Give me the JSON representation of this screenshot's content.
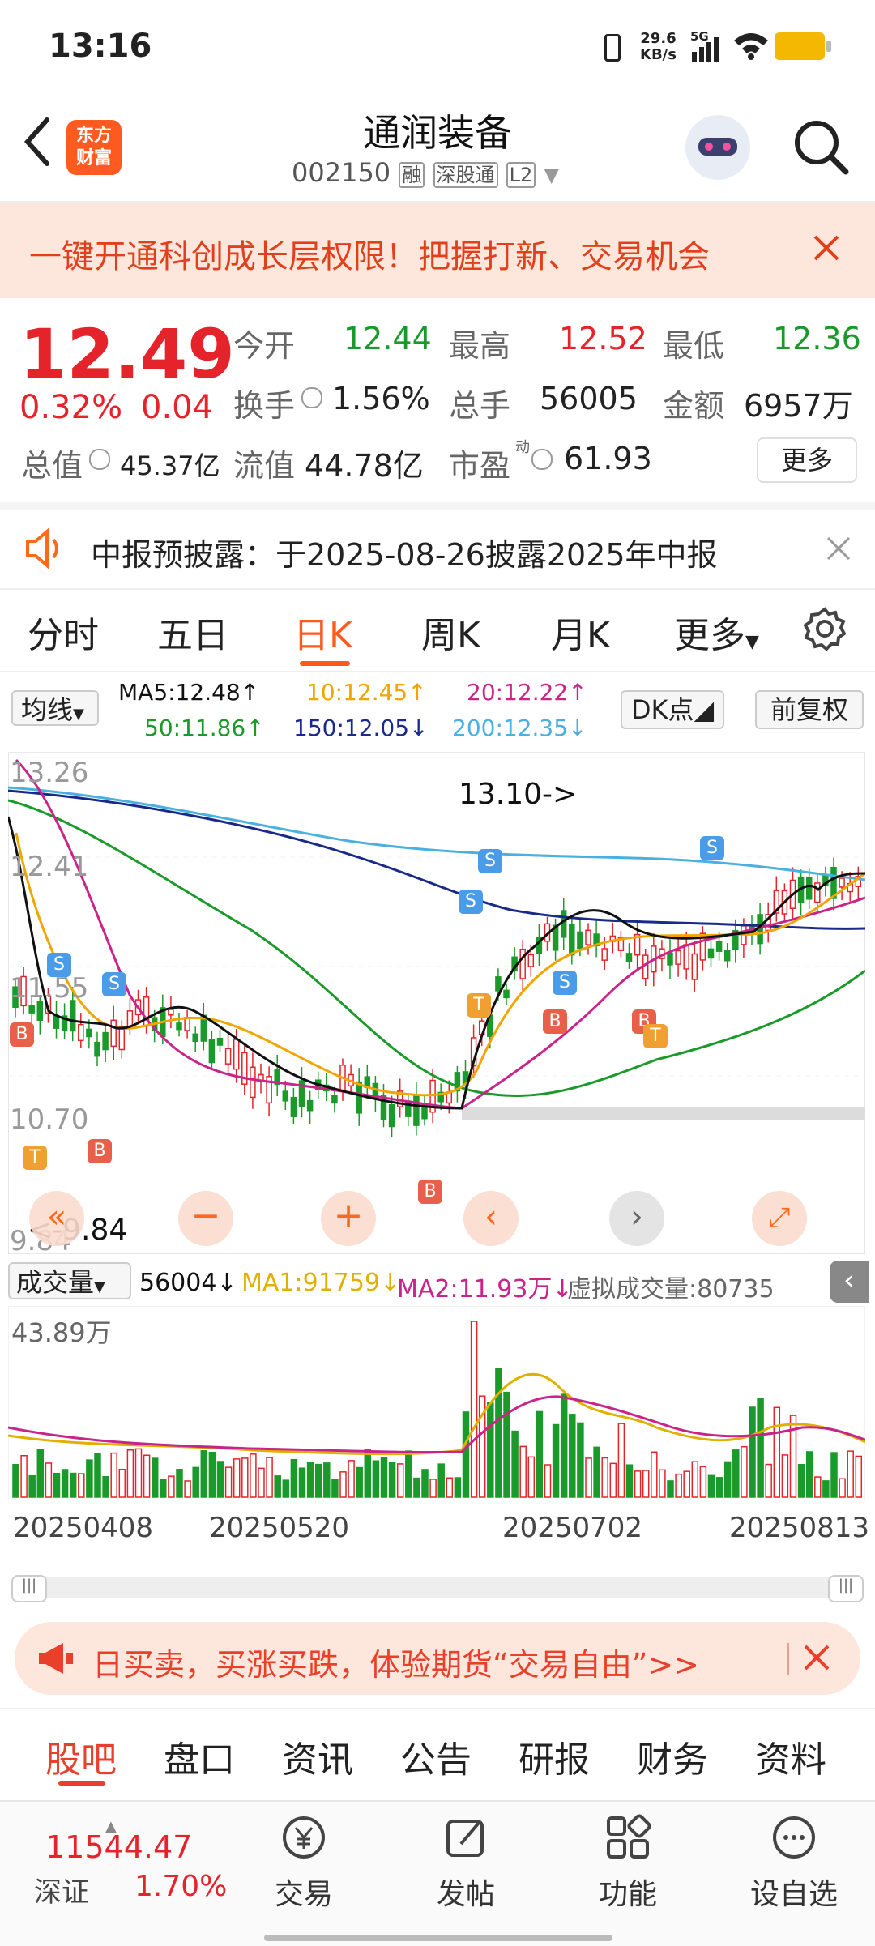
{
  "status": {
    "time": "13:16",
    "net_speed": "29.6",
    "net_unit": "KB/s",
    "signal": "5G"
  },
  "header": {
    "back": "‹",
    "logo_line1": "东方",
    "logo_line2": "财富",
    "title": "通润装备",
    "code": "002150",
    "tag1": "融",
    "tag2": "深股通",
    "tag3": "L2"
  },
  "banner": {
    "text": "一键开通科创成长层权限！把握打新、交易机会"
  },
  "quote": {
    "price": "12.49",
    "pct": "0.32%",
    "chg": "0.04",
    "open_label": "今开",
    "open": "12.44",
    "high_label": "最高",
    "high": "12.52",
    "low_label": "最低",
    "low": "12.36",
    "turnover_label": "换手",
    "turnover": "1.56%",
    "vol_label": "总手",
    "vol": "56005",
    "amount_label": "金额",
    "amount": "6957万",
    "mktcap_label": "总值",
    "mktcap": "45.37亿",
    "float_label": "流值",
    "float": "44.78亿",
    "pe_label": "市盈",
    "pe_sup": "动",
    "pe": "61.93",
    "more": "更多"
  },
  "notice": {
    "text": "中报预披露：于2025-08-26披露2025年中报"
  },
  "tabs": [
    "分时",
    "五日",
    "日K",
    "周K",
    "月K",
    "更多"
  ],
  "ma": {
    "toggle": "均线",
    "ma5": "MA5:12.48↑",
    "ma10": "10:12.45↑",
    "ma20": "20:12.22↑",
    "ma50": "50:11.86↑",
    "ma150": "150:12.05↓",
    "ma200": "200:12.35↓",
    "dk": "DK点",
    "fq": "前复权"
  },
  "chart_labels": {
    "y1": "13.26",
    "y2": "12.41",
    "y3": "11.55",
    "y4": "10.70",
    "y5": "9.84",
    "high_note": "13.10->",
    "low_note": "<-9.84"
  },
  "chart_data": {
    "type": "candlestick",
    "y_ticks": [
      13.26,
      12.41,
      11.55,
      10.7,
      9.84
    ],
    "ylim": [
      9.84,
      13.26
    ],
    "x_ticks": [
      "20250408",
      "20250520",
      "20250702",
      "20250813"
    ],
    "annotations": {
      "high": "13.10",
      "low": "9.84"
    },
    "ma_values": {
      "MA5": 12.48,
      "MA10": 12.45,
      "MA20": 12.22,
      "MA50": 11.86,
      "MA150": 12.05,
      "MA200": 12.35
    },
    "volume": {
      "current": 56004,
      "MA1": 91759,
      "MA2": "11.93万",
      "virtual": 80735,
      "max_label": "43.89万"
    }
  },
  "volume_bar": {
    "label": "成交量",
    "cur": "56004↓",
    "ma1": "MA1:91759↓",
    "ma2": "MA2:11.93万↓",
    "virtual": "虚拟成交量:80735",
    "max": "43.89万"
  },
  "dates": [
    "20250408",
    "20250520",
    "20250702",
    "20250813"
  ],
  "ad": {
    "text": "日买卖，买涨买跌，体验期货“交易自由”>>"
  },
  "subtabs": [
    "股吧",
    "盘口",
    "资讯",
    "公告",
    "研报",
    "财务",
    "资料"
  ],
  "bottom": {
    "index_value": "11544.47",
    "index_name": "深证",
    "index_pct": "1.70%",
    "trade": "交易",
    "post": "发帖",
    "func": "功能",
    "watch": "设自选"
  },
  "colors": {
    "red": "#e5232a",
    "green": "#1a9a2a",
    "accent": "#ff6a1a"
  }
}
